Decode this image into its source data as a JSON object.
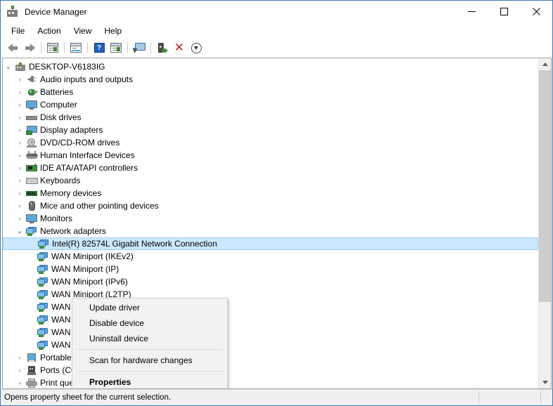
{
  "window": {
    "title": "Device Manager",
    "icon": "device-manager-icon",
    "controls": {
      "minimize": "—",
      "maximize": "☐",
      "close": "✕"
    }
  },
  "menubar": {
    "items": [
      "File",
      "Action",
      "View",
      "Help"
    ]
  },
  "toolbar": {
    "buttons": [
      {
        "name": "back-icon",
        "type": "arrow-left"
      },
      {
        "name": "forward-icon",
        "type": "arrow-right"
      },
      {
        "name": "separator",
        "type": "sep"
      },
      {
        "name": "show-hide-console-tree-icon",
        "type": "panel-tree"
      },
      {
        "name": "separator",
        "type": "sep"
      },
      {
        "name": "properties-icon",
        "type": "panel-props"
      },
      {
        "name": "separator",
        "type": "sep"
      },
      {
        "name": "help-icon",
        "type": "help"
      },
      {
        "name": "show-hide-action-pane-icon",
        "type": "panel-action"
      },
      {
        "name": "separator",
        "type": "sep"
      },
      {
        "name": "scan-for-hardware-changes-icon",
        "type": "monitor-scan"
      },
      {
        "name": "separator",
        "type": "sep"
      },
      {
        "name": "update-driver-icon",
        "type": "plug-green"
      },
      {
        "name": "uninstall-device-icon",
        "type": "red-x"
      },
      {
        "name": "disable-device-icon",
        "type": "down-circle"
      }
    ]
  },
  "tree": {
    "root": {
      "label": "DESKTOP-V6183IG",
      "icon": "computer-icon",
      "expanded": true
    },
    "items": [
      {
        "label": "Audio inputs and outputs",
        "icon": "speaker-icon",
        "indent": 1,
        "expanded": false
      },
      {
        "label": "Batteries",
        "icon": "battery-icon",
        "indent": 1,
        "expanded": false
      },
      {
        "label": "Computer",
        "icon": "monitor-icon",
        "indent": 1,
        "expanded": false
      },
      {
        "label": "Disk drives",
        "icon": "disk-drive-icon",
        "indent": 1,
        "expanded": false
      },
      {
        "label": "Display adapters",
        "icon": "display-adapter-icon",
        "indent": 1,
        "expanded": false
      },
      {
        "label": "DVD/CD-ROM drives",
        "icon": "dvd-drive-icon",
        "indent": 1,
        "expanded": false
      },
      {
        "label": "Human Interface Devices",
        "icon": "hid-icon",
        "indent": 1,
        "expanded": false
      },
      {
        "label": "IDE ATA/ATAPI controllers",
        "icon": "ide-controller-icon",
        "indent": 1,
        "expanded": false
      },
      {
        "label": "Keyboards",
        "icon": "keyboard-icon",
        "indent": 1,
        "expanded": false
      },
      {
        "label": "Memory devices",
        "icon": "memory-icon",
        "indent": 1,
        "expanded": false
      },
      {
        "label": "Mice and other pointing devices",
        "icon": "mouse-icon",
        "indent": 1,
        "expanded": false
      },
      {
        "label": "Monitors",
        "icon": "monitor-icon",
        "indent": 1,
        "expanded": false
      },
      {
        "label": "Network adapters",
        "icon": "network-adapter-icon",
        "indent": 1,
        "expanded": true
      }
    ],
    "network_children": [
      {
        "label": "Intel(R) 82574L Gigabit Network Connection",
        "icon": "network-adapter-icon",
        "indent": 2,
        "selected": true,
        "obscured": true
      },
      {
        "label": "WAN Miniport (IKEv2)",
        "icon": "network-adapter-icon",
        "indent": 2,
        "obscured": true
      },
      {
        "label": "WAN Miniport (IP)",
        "icon": "network-adapter-icon",
        "indent": 2,
        "obscured": true
      },
      {
        "label": "WAN Miniport (IPv6)",
        "icon": "network-adapter-icon",
        "indent": 2,
        "obscured": true
      },
      {
        "label": "WAN Miniport (L2TP)",
        "icon": "network-adapter-icon",
        "indent": 2,
        "obscured": true
      },
      {
        "label": "WAN Miniport (Network Monitor)",
        "icon": "network-adapter-icon",
        "indent": 2,
        "obscured": true
      },
      {
        "label": "WAN Miniport (PPPOE)",
        "icon": "network-adapter-icon",
        "indent": 2,
        "obscured": true
      },
      {
        "label": "WAN Miniport (PPTP)",
        "icon": "network-adapter-icon",
        "indent": 2,
        "obscured": true
      },
      {
        "label": "WAN Miniport (SSTP)",
        "icon": "network-adapter-icon",
        "indent": 2,
        "obscured": false
      }
    ],
    "items_after": [
      {
        "label": "Portable Devices",
        "icon": "portable-device-icon",
        "indent": 1,
        "expanded": false
      },
      {
        "label": "Ports (COM & LPT)",
        "icon": "port-icon",
        "indent": 1,
        "expanded": false
      },
      {
        "label": "Print queues",
        "icon": "printer-icon",
        "indent": 1,
        "expanded": false
      }
    ],
    "chevron_collapsed": "›",
    "chevron_expanded": "⌄"
  },
  "context_menu": {
    "items": [
      {
        "label": "Update driver",
        "bold": false,
        "type": "item"
      },
      {
        "label": "Disable device",
        "bold": false,
        "type": "item"
      },
      {
        "label": "Uninstall device",
        "bold": false,
        "type": "item"
      },
      {
        "label": "",
        "type": "separator"
      },
      {
        "label": "Scan for hardware changes",
        "bold": false,
        "type": "item"
      },
      {
        "label": "",
        "type": "separator"
      },
      {
        "label": "Properties",
        "bold": true,
        "type": "item"
      }
    ]
  },
  "statusbar": {
    "message": "Opens property sheet for the current selection.",
    "pane2": "",
    "pane3": ""
  },
  "scrollbar": {
    "up_arrow": "▲",
    "down_arrow": "▼"
  },
  "colors": {
    "window_border": "#3d7bb5",
    "selection": "#cce8ff",
    "accent_blue": "#5aa9de",
    "green": "#3f8f3f",
    "red_x": "#d51a1a"
  }
}
